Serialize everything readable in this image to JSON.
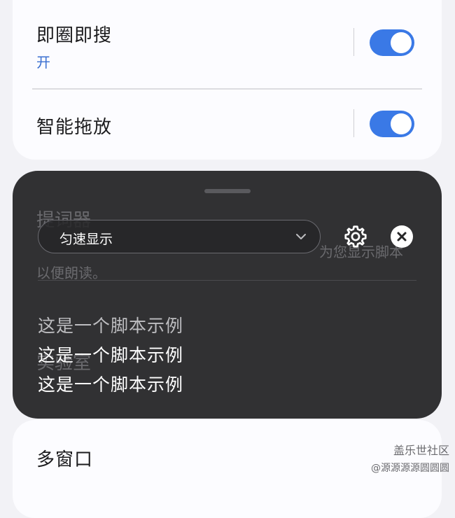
{
  "settings": {
    "circle_search": {
      "title": "即圈即搜",
      "status": "开"
    },
    "smart_drag": {
      "title": "智能拖放"
    },
    "teleprompter": {
      "title": "提词器",
      "desc_part": "为您显示脚本",
      "desc_line2": "以便朗读。"
    },
    "labs": {
      "title": "实验室"
    },
    "multi_window": {
      "title": "多窗口"
    }
  },
  "overlay": {
    "mode_value": "匀速显示",
    "script_lines": [
      "这是一个脚本示例",
      "这是一个脚本示例",
      "这是一个脚本示例"
    ]
  },
  "watermark": {
    "line1": "盖乐世社区",
    "line2": "@源源源源圆圆圆"
  },
  "colors": {
    "accent": "#3a79e6",
    "link": "#3a6fd0",
    "overlay_bg": "#262628"
  },
  "icons": {
    "dropdown": "chevron-down-icon",
    "settings": "gear-icon",
    "close": "close-icon"
  }
}
